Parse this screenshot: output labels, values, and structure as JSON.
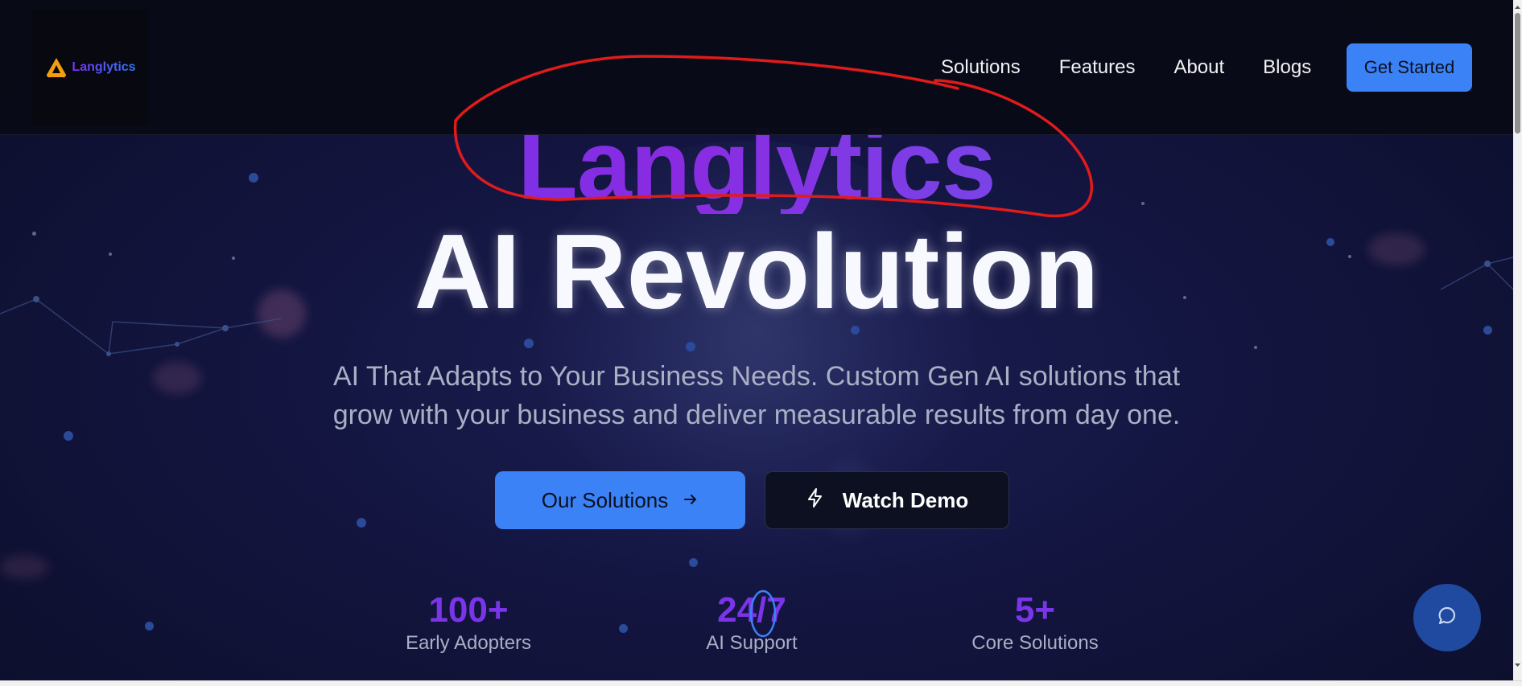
{
  "brand": {
    "logo_text": "Langlytics",
    "accent": "#3b82f6",
    "purple": "#7b35e8"
  },
  "nav": {
    "links": [
      "Solutions",
      "Features",
      "About",
      "Blogs"
    ],
    "cta": "Get Started"
  },
  "hero": {
    "brand_title": "Langlytics",
    "headline": "AI Revolution",
    "subtitle_line1": "AI That Adapts to Your Business Needs. Custom Gen AI solutions that",
    "subtitle_line2": "grow with your business and deliver measurable results from day one.",
    "primary_button": "Our Solutions",
    "secondary_button": "Watch Demo"
  },
  "stats": [
    {
      "value": "100+",
      "label": "Early Adopters"
    },
    {
      "value": "24/7",
      "label": "AI Support"
    },
    {
      "value": "5+",
      "label": "Core Solutions"
    }
  ],
  "icons": {
    "logo": "langlytics-logo-icon",
    "primary_button": "arrow-right-icon",
    "secondary_button": "lightning-icon",
    "chat": "chat-bubble-icon"
  }
}
